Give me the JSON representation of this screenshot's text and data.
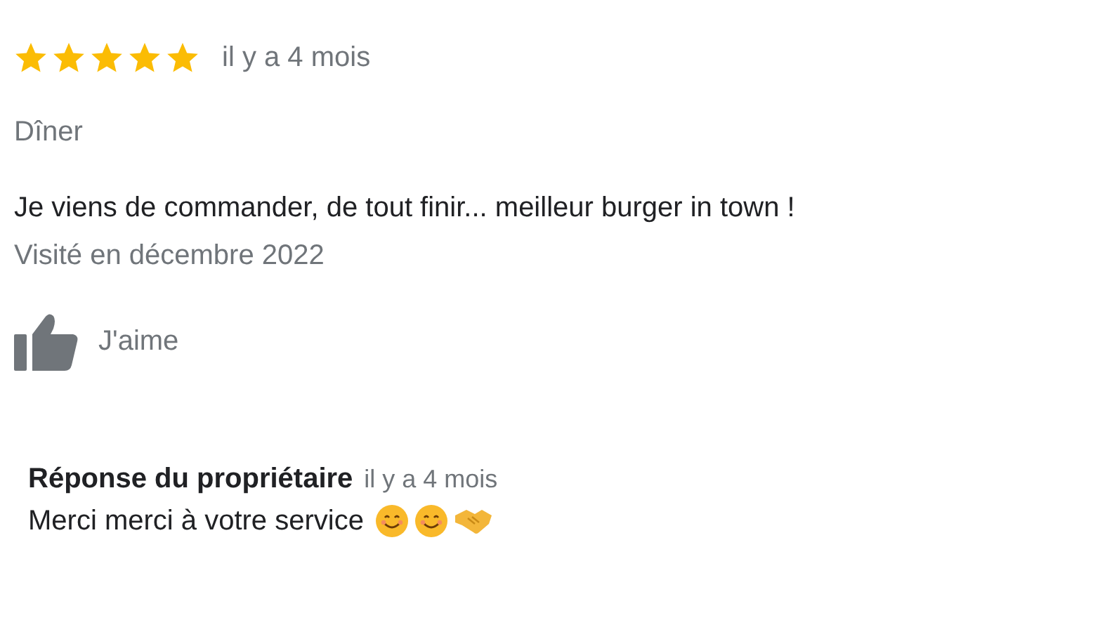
{
  "review": {
    "stars": 5,
    "time": "il y a 4 mois",
    "meal_type": "Dîner",
    "text": "Je viens de commander, de tout finir... meilleur burger in town !",
    "visited": "Visité en décembre 2022",
    "like_label": "J'aime"
  },
  "owner_response": {
    "title": "Réponse du propriétaire",
    "time": "il y a 4 mois",
    "text": "Merci merci à votre service"
  }
}
